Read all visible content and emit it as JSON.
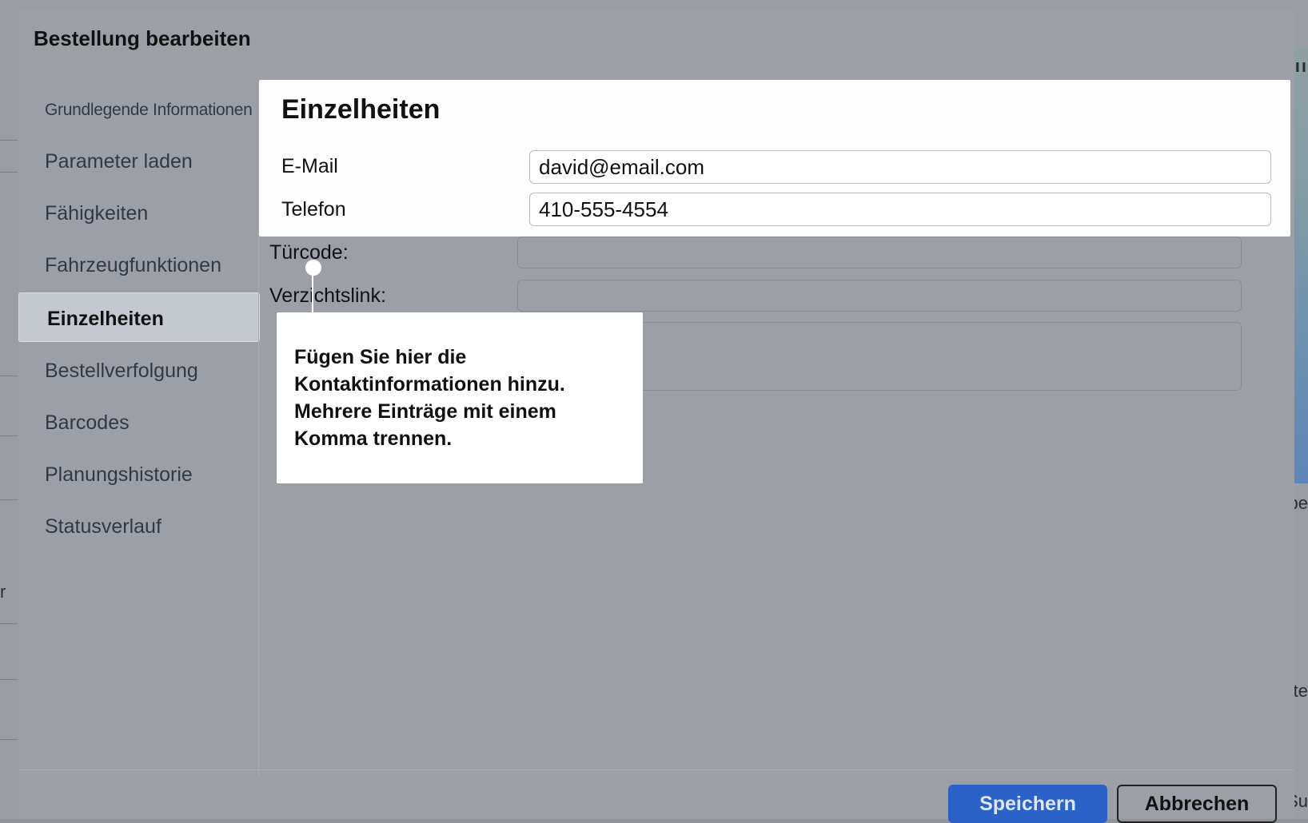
{
  "dialog": {
    "title": "Bestellung bearbeiten"
  },
  "sidebar": {
    "items": [
      {
        "label": "Grundlegende Informationen"
      },
      {
        "label": "Parameter laden"
      },
      {
        "label": "Fähigkeiten"
      },
      {
        "label": "Fahrzeugfunktionen"
      },
      {
        "label": "Einzelheiten",
        "active": true
      },
      {
        "label": "Bestellverfolgung"
      },
      {
        "label": "Barcodes"
      },
      {
        "label": "Planungshistorie"
      },
      {
        "label": "Statusverlauf"
      }
    ]
  },
  "details": {
    "title": "Einzelheiten",
    "email": {
      "label": "E-Mail",
      "value": "david@email.com"
    },
    "phone": {
      "label": "Telefon",
      "value": "410-555-4554"
    },
    "door_code": {
      "label": "Türcode:",
      "value": ""
    },
    "waiver_link": {
      "label": "Verzichtslink:",
      "value": ""
    }
  },
  "tooltip": {
    "lines": [
      "Fügen Sie hier die",
      "Kontaktinformationen hinzu.",
      "Mehrere Einträge mit einem",
      "Komma trennen."
    ]
  },
  "footer": {
    "save_label": "Speichern",
    "cancel_label": "Abbrechen"
  },
  "background": {
    "fragments": [
      "pe",
      "te",
      "Su",
      "r",
      "ıı"
    ]
  },
  "colors": {
    "accent": "#2b62c8",
    "overlay": "#9ca0a6",
    "highlight": "#fdfdfd"
  }
}
